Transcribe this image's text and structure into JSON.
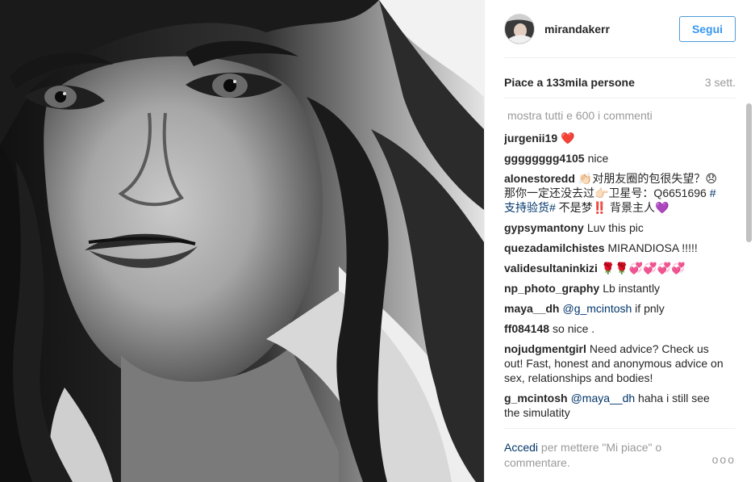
{
  "photo": {
    "alt": ""
  },
  "header": {
    "username": "mirandakerr",
    "follow_label": "Segui"
  },
  "stats": {
    "likes": "Piace a 133mila persone",
    "time": "3 sett."
  },
  "comments": {
    "view_all": "mostra tutti e 600 i commenti",
    "items": [
      {
        "user": "jurgenii19",
        "text": "❤️"
      },
      {
        "user": "gggggggg4105",
        "text": "nice"
      },
      {
        "user": "alonestoredd",
        "text": "👏🏻对朋友圈的包很失望？😞 那你一定还没去过👉🏻卫星号：Q6651696 ",
        "tag": "#支持验货#",
        "text2": " 不是梦‼️ 背景主人💜"
      },
      {
        "user": "gypsymantony",
        "text": "Luv this pic"
      },
      {
        "user": "quezadamilchistes",
        "text": "MIRANDIOSA !!!!!"
      },
      {
        "user": "validesultaninkizi",
        "text": "🌹🌹💞💞💞💞"
      },
      {
        "user": "np_photo_graphy",
        "text": "Lb instantly"
      },
      {
        "user": "maya__dh",
        "mention": "@g_mcintosh",
        "text": " if pnly"
      },
      {
        "user": "ff084148",
        "text": "so nice ."
      },
      {
        "user": "nojudgmentgirl",
        "text": "Need advice? Check us out! Fast, honest and anonymous advice on sex, relationships and bodies!"
      },
      {
        "user": "g_mcintosh",
        "mention": "@maya__dh",
        "text": " haha i still see the simulatity"
      }
    ]
  },
  "footer": {
    "login": "Accedi",
    "rest": " per mettere \"Mi piace\" o commentare.",
    "more": "ooo"
  }
}
